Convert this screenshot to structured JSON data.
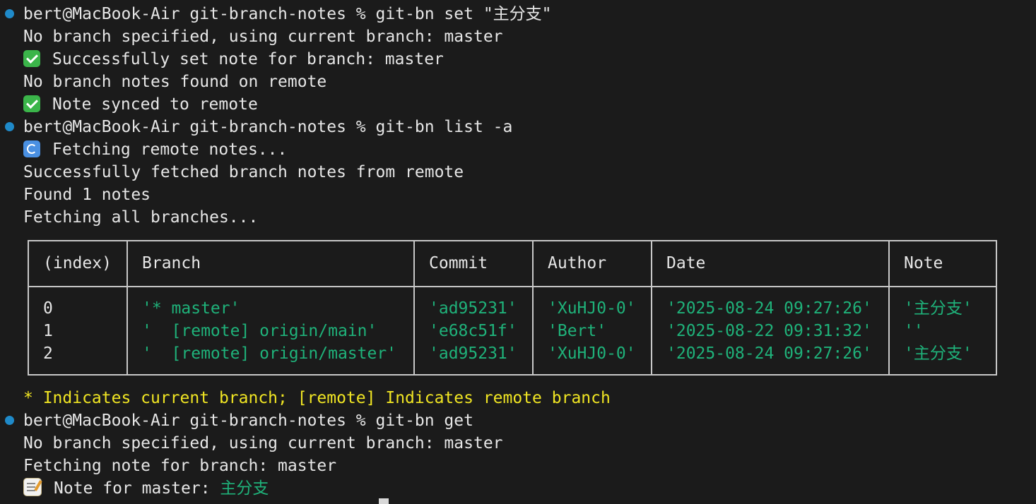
{
  "terminal": {
    "lines": [
      {
        "type": "prompt",
        "text": "bert@MacBook-Air git-branch-notes % git-bn set \"主分支\""
      },
      {
        "type": "output",
        "text": "No branch specified, using current branch: master"
      },
      {
        "type": "output",
        "icon": "check-icon",
        "text": "Successfully set note for branch: master"
      },
      {
        "type": "output",
        "text": "No branch notes found on remote"
      },
      {
        "type": "output",
        "icon": "check-icon",
        "text": "Note synced to remote"
      },
      {
        "type": "prompt",
        "text": "bert@MacBook-Air git-branch-notes % git-bn list -a"
      },
      {
        "type": "output",
        "icon": "refresh-icon",
        "text": "Fetching remote notes..."
      },
      {
        "type": "output",
        "text": "Successfully fetched branch notes from remote"
      },
      {
        "type": "output",
        "text": "Found 1 notes"
      },
      {
        "type": "output",
        "text": "Fetching all branches..."
      },
      {
        "type": "legend",
        "text": "* Indicates current branch; [remote] Indicates remote branch"
      },
      {
        "type": "prompt",
        "text": "bert@MacBook-Air git-branch-notes % git-bn get"
      },
      {
        "type": "output",
        "text": "No branch specified, using current branch: master"
      },
      {
        "type": "output",
        "text": "Fetching note for branch: master"
      },
      {
        "type": "output",
        "icon": "memo-icon",
        "text": "Note for master: ",
        "highlight": "主分支"
      }
    ],
    "table": {
      "headers": [
        "(index)",
        "Branch",
        "Commit",
        "Author",
        "Date",
        "Note"
      ],
      "rows": [
        [
          "0",
          "'* master'",
          "'ad95231'",
          "'XuHJ0-0'",
          "'2025-08-24 09:27:26'",
          "'主分支'"
        ],
        [
          "1",
          "'  [remote] origin/main'",
          "'e68c51f'",
          "'Bert'",
          "'2025-08-22 09:31:32'",
          "''"
        ],
        [
          "2",
          "'  [remote] origin/master'",
          "'ad95231'",
          "'XuHJ0-0'",
          "'2025-08-24 09:27:26'",
          "'主分支'"
        ]
      ]
    },
    "colors": {
      "background": "#1b1b1b",
      "text": "#e6e6e6",
      "value": "#1fb27a",
      "legend": "#f0e523",
      "prompt_dot": "#1f8ac9"
    }
  }
}
